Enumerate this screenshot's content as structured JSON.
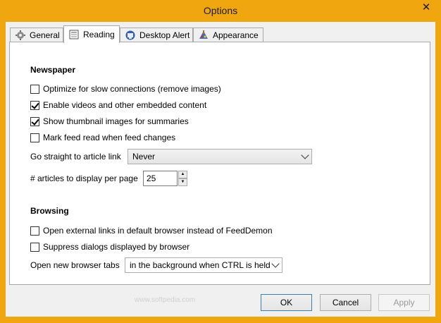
{
  "window": {
    "title": "Options",
    "close_glyph": "✕"
  },
  "tabs": [
    {
      "label": "General",
      "icon": "gear-icon"
    },
    {
      "label": "Reading",
      "icon": "newspaper-icon"
    },
    {
      "label": "Desktop Alert",
      "icon": "alert-icon"
    },
    {
      "label": "Appearance",
      "icon": "palette-icon"
    }
  ],
  "active_tab": "Reading",
  "newspaper": {
    "title": "Newspaper",
    "options": [
      {
        "label": "Optimize for slow connections (remove images)",
        "checked": false
      },
      {
        "label": "Enable videos and other embedded content",
        "checked": true
      },
      {
        "label": "Show thumbnail images for summaries",
        "checked": true
      },
      {
        "label": "Mark feed read when feed changes",
        "checked": false
      }
    ],
    "article_link_label": "Go straight to article link",
    "article_link_value": "Never",
    "articles_per_page_label": "# articles to display per page",
    "articles_per_page_value": "25"
  },
  "browsing": {
    "title": "Browsing",
    "options": [
      {
        "label": "Open external links in default browser instead of FeedDemon",
        "checked": false
      },
      {
        "label": "Suppress dialogs displayed by browser",
        "checked": false
      }
    ],
    "new_tabs_label": "Open new browser tabs",
    "new_tabs_value": "in the background when CTRL is held"
  },
  "footer": {
    "ok": "OK",
    "cancel": "Cancel",
    "apply": "Apply"
  },
  "watermark": "www.softpedia.com",
  "colors": {
    "title_bar": "#f0a70f",
    "panel": "#ffffff",
    "dialog": "#f0f0f0"
  }
}
